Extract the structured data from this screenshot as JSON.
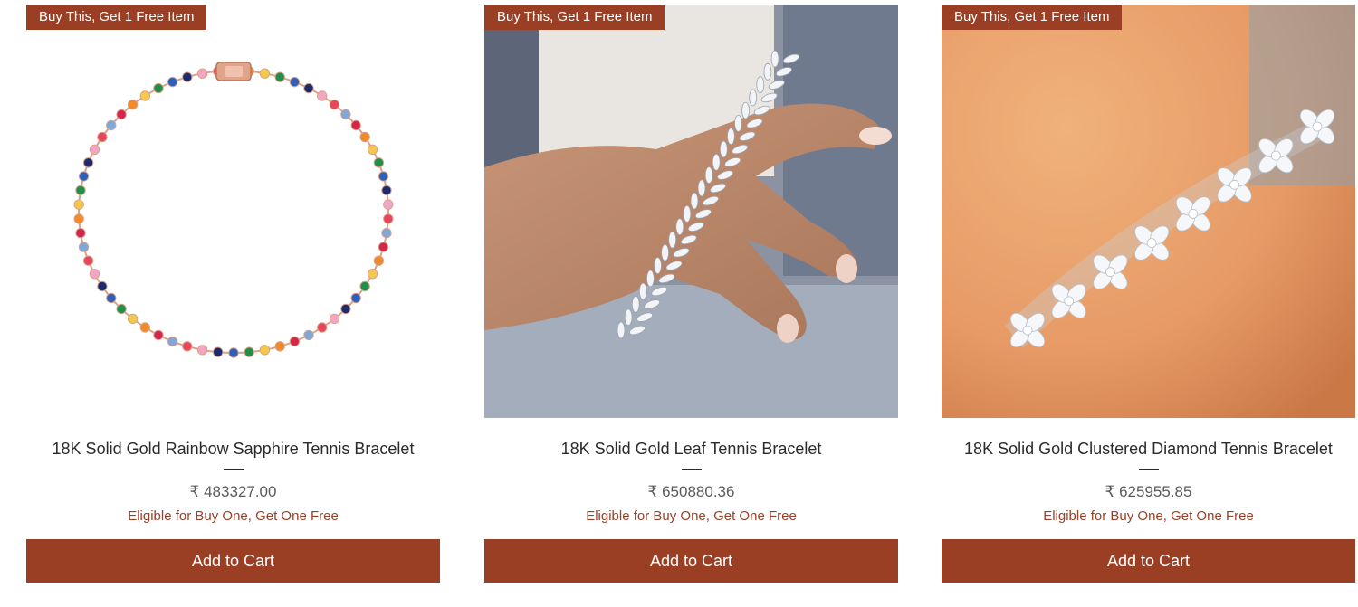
{
  "colors": {
    "accent": "#9a3f24",
    "text": "#2b2b2b",
    "price": "#5a5a5a"
  },
  "products": [
    {
      "ribbon": "Buy This, Get 1 Free Item",
      "title": "18K Solid Gold Rainbow Sapphire Tennis Bracelet",
      "price": "₹ 483327.00",
      "offer": "Eligible for Buy One, Get One Free",
      "button": "Add to Cart",
      "image": "rainbow-sapphire-bracelet-photo"
    },
    {
      "ribbon": "Buy This, Get 1 Free Item",
      "title": "18K Solid Gold Leaf Tennis Bracelet",
      "price": "₹ 650880.36",
      "offer": "Eligible for Buy One, Get One Free",
      "button": "Add to Cart",
      "image": "leaf-bracelet-on-hand-photo"
    },
    {
      "ribbon": "Buy This, Get 1 Free Item",
      "title": "18K Solid Gold Clustered Diamond Tennis Bracelet",
      "price": "₹ 625955.85",
      "offer": "Eligible for Buy One, Get One Free",
      "button": "Add to Cart",
      "image": "clustered-diamond-bracelet-on-wrist-photo"
    }
  ]
}
